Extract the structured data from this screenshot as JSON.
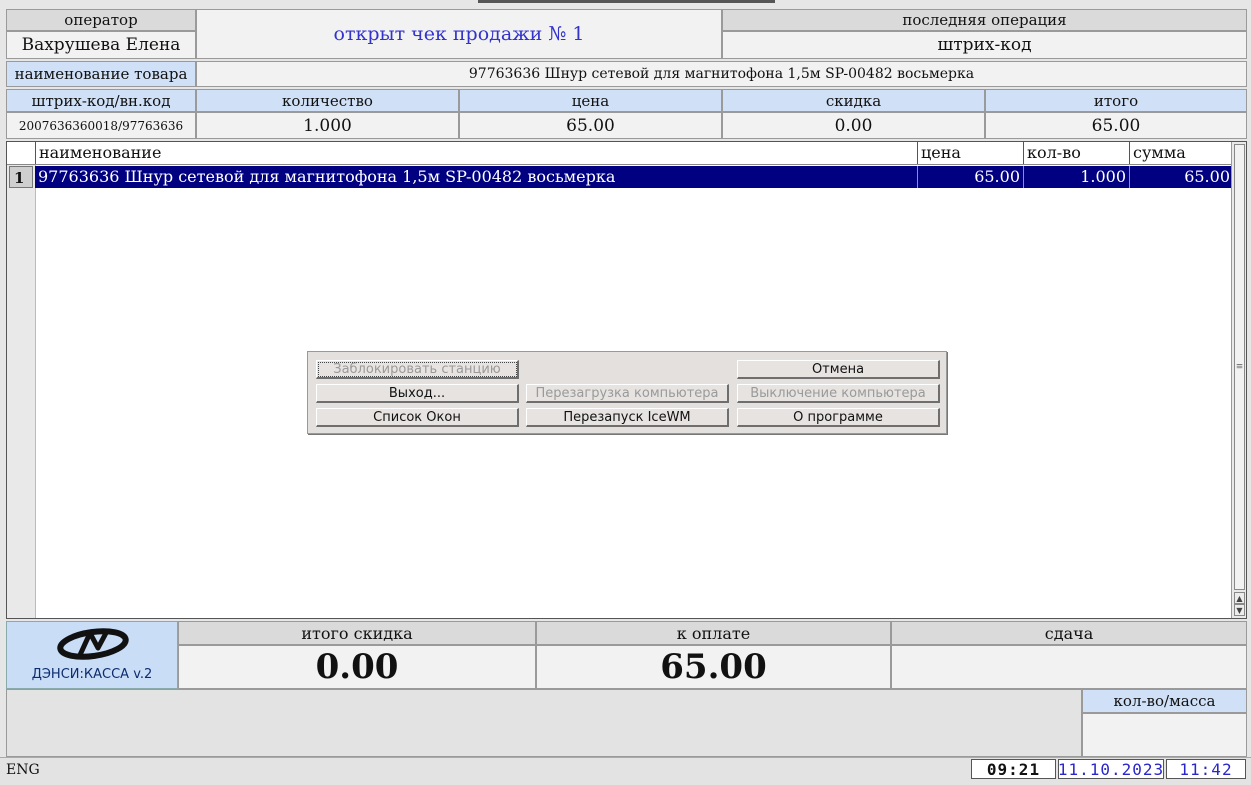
{
  "header": {
    "operator_label": "оператор",
    "operator_name": "Вахрушева Елена",
    "receipt_status": "открыт чек продажи № 1",
    "last_op_label": "последняя операция",
    "last_op_value": "штрих-код",
    "item_name_label": "наименование товара",
    "item_name_value": "97763636 Шнур сетевой для магнитофона 1,5м SP-00482 восьмерка",
    "barcode_label": "штрих-код/вн.код",
    "qty_label": "количество",
    "price_label": "цена",
    "discount_label": "скидка",
    "total_label": "итого",
    "barcode_value": "2007636360018/97763636",
    "qty_value": "1.000",
    "price_value": "65.00",
    "discount_value": "0.00",
    "total_value": "65.00"
  },
  "table": {
    "columns": [
      "наименование",
      "цена",
      "кол-во",
      "сумма"
    ],
    "rows": [
      {
        "num": "1",
        "name": "97763636 Шнур сетевой для магнитофона 1,5м SP-00482 восьмерка",
        "price": "65.00",
        "qty": "1.000",
        "sum": "65.00"
      }
    ]
  },
  "dialog": {
    "lock": "Заблокировать станцию",
    "cancel": "Отмена",
    "exit": "Выход...",
    "reboot": "Перезагрузка компьютера",
    "shutdown": "Выключение компьютера",
    "window_list": "Список Окон",
    "restart_wm": "Перезапуск IceWM",
    "about": "О программе"
  },
  "footer": {
    "logo_text": "ДЭНСИ:КАССА v.2",
    "total_discount_label": "итого скидка",
    "total_discount_value": "0.00",
    "to_pay_label": "к оплате",
    "to_pay_value": "65.00",
    "change_label": "сдача",
    "change_value": "",
    "qty_mass_label": "кол-во/масса",
    "qty_mass_value": ""
  },
  "statusbar": {
    "lang": "ENG",
    "clock1": "09:21",
    "date": "11.10.2023",
    "clock2": "11:42"
  },
  "colors": {
    "selection": "#000080",
    "label_blue": "#cfe0f7",
    "accent_text": "#3333cc"
  }
}
